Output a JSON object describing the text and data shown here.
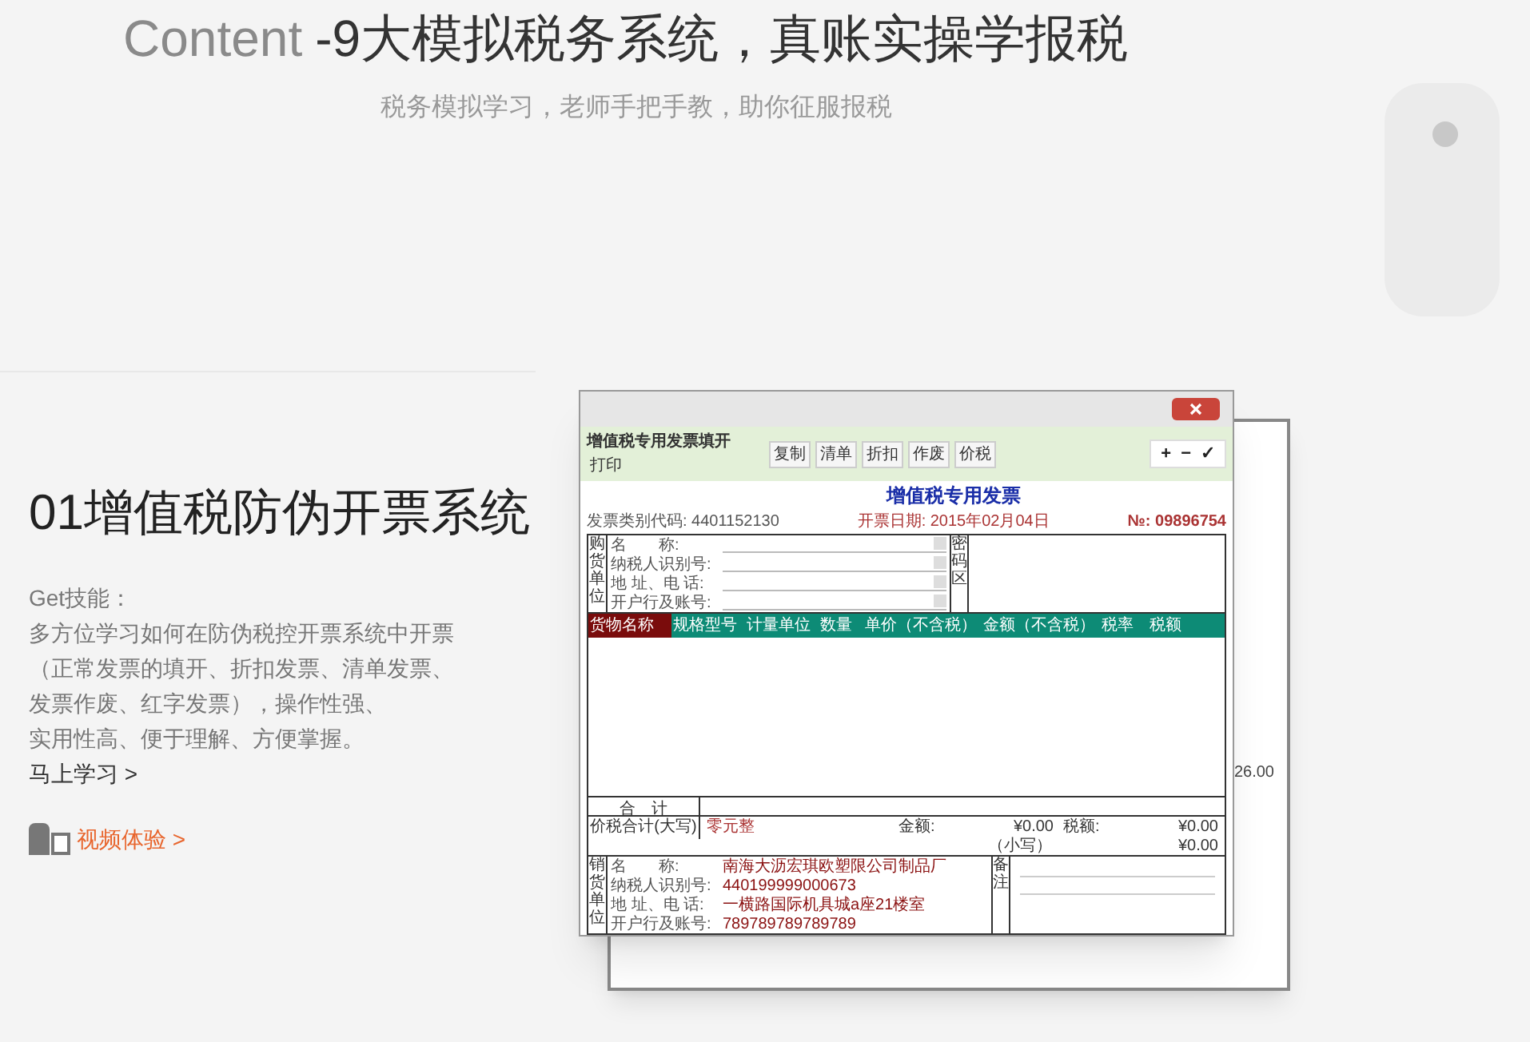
{
  "header": {
    "title_prefix": "Content",
    "title": "-9大模拟税务系统，真账实操学报税",
    "subtitle": "税务模拟学习，老师手把手教，助你征服报税"
  },
  "feature": {
    "heading": "01增值税防伪开票系统",
    "skills_label": "Get技能：",
    "description_lines": [
      "多方位学习如何在防伪税控开票系统中开票",
      "（正常发票的填开、折扣发票、清单发票、",
      "发票作废、红字发票），操作性强、",
      "实用性高、便于理解、方便掌握。"
    ],
    "learn_link": "马上学习 >",
    "video_link": "视频体验 >"
  },
  "app_window": {
    "window_title": "增值税专用发票填开",
    "left_tools": [
      "打印"
    ],
    "tools": [
      "复制",
      "清单",
      "折扣",
      "作废",
      "价税"
    ],
    "nav_glyphs": [
      "+",
      "−",
      "✓"
    ],
    "invoice_title": "增值税专用发票",
    "invoice_number": "№: 09896754",
    "invoice_date": "开票日期: 2015年02月04日",
    "invoice_code": "发票类别代码: 4401152130",
    "buyer_label": "购货单位",
    "buyer_fields": [
      "名　　称:",
      "纳税人识别号:",
      "地 址、电 话:",
      "开户行及账号:"
    ],
    "cipher_label": "密码区",
    "columns": [
      {
        "label": "货物名称",
        "selected": true
      },
      {
        "label": "规格型号",
        "selected": false
      },
      {
        "label": "计量单位",
        "selected": false
      },
      {
        "label": "数量",
        "selected": false
      },
      {
        "label": "单价（不含税）",
        "selected": false
      },
      {
        "label": "金额（不含税）",
        "selected": false
      },
      {
        "label": "税率",
        "selected": false
      },
      {
        "label": "税额",
        "selected": false
      }
    ],
    "total_label": "合　计",
    "total_words_label": "价税合计(大写)",
    "total_words": "零元整",
    "amount_label": "金额:",
    "amount": "¥0.00",
    "tax_label": "税额:",
    "tax": "¥0.00",
    "small_label": "（小写）",
    "small_total": "¥0.00",
    "seller_label": "销货单位",
    "seller_fields": [
      {
        "label": "名　　称:",
        "value": "南海大沥宏琪欧塑限公司制品厂"
      },
      {
        "label": "纳税人识别号:",
        "value": "440199999000673"
      },
      {
        "label": "地 址、电 话:",
        "value": "一横路国际机具城a座21楼室"
      },
      {
        "label": "开户行及账号:",
        "value": "789789789789789"
      }
    ],
    "remark_label": "备注",
    "back_window_amount": "26.00"
  }
}
